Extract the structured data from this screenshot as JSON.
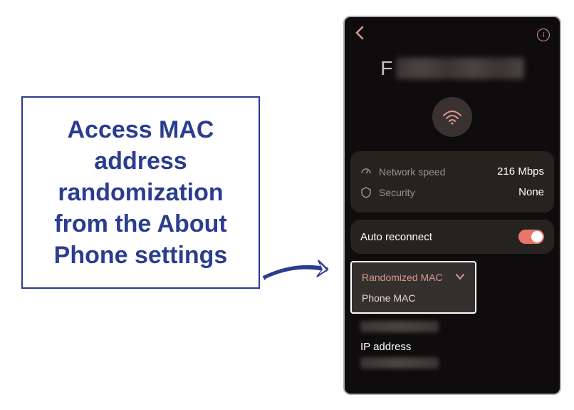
{
  "callout": {
    "text": "Access MAC address randomization from the About Phone settings"
  },
  "phone": {
    "network_name_first_letter": "F",
    "speed": {
      "label": "Network speed",
      "value": "216 Mbps"
    },
    "security": {
      "label": "Security",
      "value": "None"
    },
    "auto_reconnect": {
      "label": "Auto reconnect",
      "enabled": true
    },
    "mac_dropdown": {
      "selected": "Randomized MAC",
      "option2": "Phone MAC"
    },
    "ip": {
      "label": "IP address"
    }
  }
}
